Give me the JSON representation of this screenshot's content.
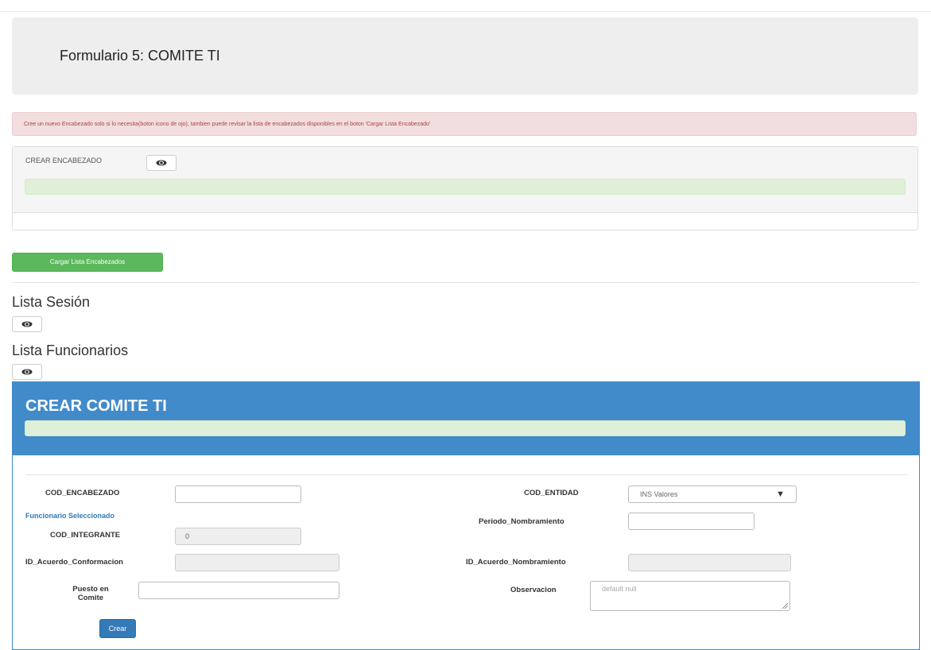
{
  "header": {
    "title": "Formulario 5: COMITE TI"
  },
  "alert": {
    "text": "Cree un nuevo Encabezado solo si lo necesita(boton icono de ojo), tambien puede revisar la lista de encabezados disponibles en el boton 'Cargar Lista Encabezado'"
  },
  "encabezado_panel": {
    "label": "CREAR ENCABEZADO",
    "toggle_icon": "eye-icon"
  },
  "cargar_button": {
    "label": "Cargar Lista Encabezados"
  },
  "lista_sesion": {
    "title": "Lista Sesión",
    "toggle_icon": "eye-icon"
  },
  "lista_funcionarios": {
    "title": "Lista Funcionarios",
    "toggle_icon": "eye-icon"
  },
  "comite_panel": {
    "title": "CREAR COMITE TI",
    "fields": {
      "cod_encabezado": {
        "label": "COD_ENCABEZADO",
        "value": ""
      },
      "funcionario_seleccionado": {
        "label": "Funcionario Seleccionado"
      },
      "cod_integrante": {
        "label": "COD_INTEGRANTE",
        "value": "0"
      },
      "id_acuerdo_conformacion": {
        "label": "ID_Acuerdo_Conformacion",
        "value": ""
      },
      "puesto_en_comite": {
        "label_line1": "Puesto en",
        "label_line2": "Comite",
        "value": ""
      },
      "cod_entidad": {
        "label": "COD_ENTIDAD",
        "selected": "INS Valores"
      },
      "periodo_nombramiento": {
        "label": "Periodo_Nombramiento",
        "value": ""
      },
      "id_acuerdo_nombramiento": {
        "label": "ID_Acuerdo_Nombramiento",
        "value": ""
      },
      "observacion": {
        "label": "Observacion",
        "placeholder": "default null"
      }
    },
    "submit_label": "Crear"
  },
  "colors": {
    "primary": "#428bca",
    "success": "#5cb85c",
    "alert_bg": "#f2dede",
    "alert_text": "#a94442",
    "success_bar": "#dff0d8"
  }
}
